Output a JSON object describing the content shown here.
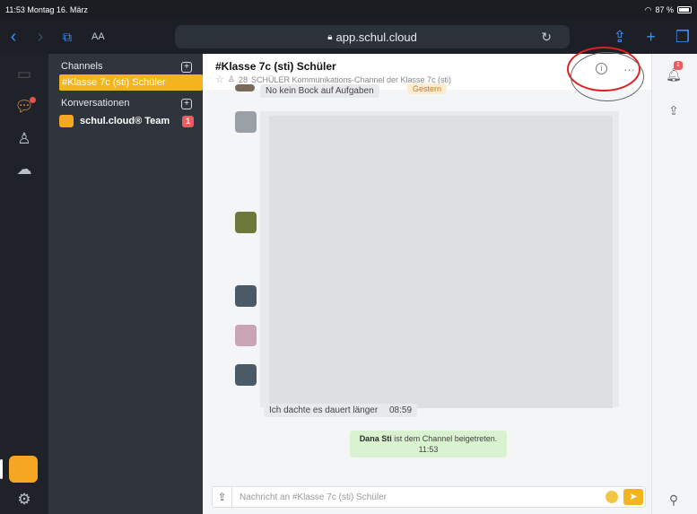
{
  "status_bar": {
    "time_date": "11:53  Montag 16. März",
    "battery": "87 %"
  },
  "browser": {
    "aa_label": "AA",
    "url": "app.schul.cloud"
  },
  "sidebar": {
    "channels_heading": "Channels",
    "active_channel": "#Klasse 7c (sti) Schüler",
    "conversations_heading": "Konversationen",
    "team_conversation": "schul.cloud® Team",
    "team_badge": "1"
  },
  "channel": {
    "title": "#Klasse 7c (sti) Schüler",
    "member_count": "28",
    "description": "SCHÜLER Kommunikations-Channel der Klasse 7c (sti)"
  },
  "messages": {
    "top_partial": "No kein Bock auf Aufgaben",
    "date_chip": "Gestern",
    "bottom_partial": "Ich dachte es dauert länger",
    "bottom_time": "08:59"
  },
  "system_message": {
    "user": "Dana Sti",
    "text": "ist dem Channel beigetreten.",
    "time": "11:53"
  },
  "composer": {
    "placeholder": "Nachricht an #Klasse 7c (sti) Schüler"
  },
  "right_rail": {
    "notifications_badge": "1"
  },
  "colors": {
    "accent": "#f2b41f",
    "sidebar": "#2f343d",
    "badge": "#ee5d5d"
  }
}
